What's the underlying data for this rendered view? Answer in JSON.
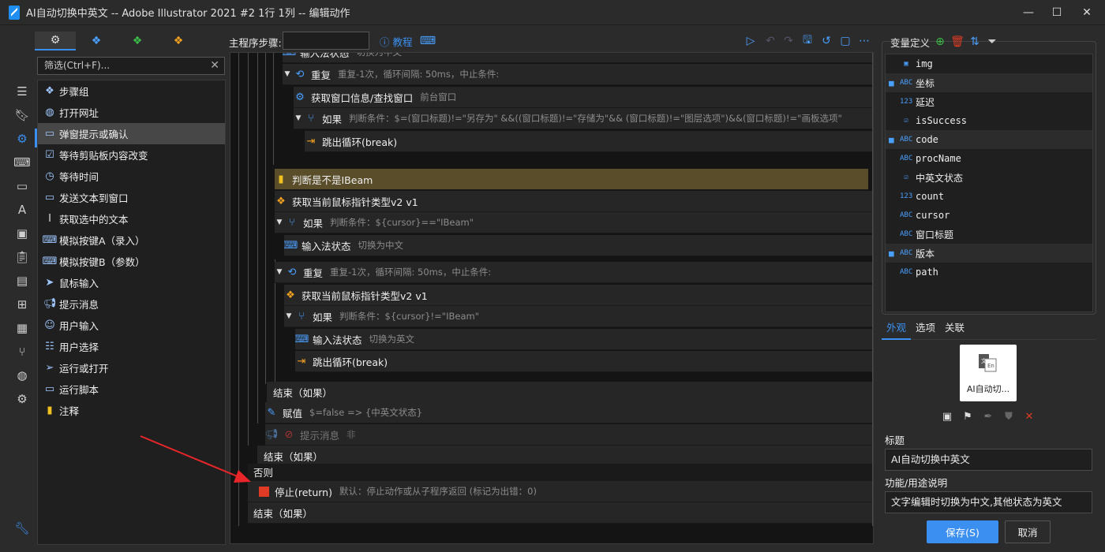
{
  "window": {
    "title": "AI自动切换中英文 -- Adobe Illustrator 2021 #2 1行 1列 -- 编辑动作",
    "controls": {
      "minimize": "—",
      "maximize": "☐",
      "close": "✕"
    }
  },
  "left_panel": {
    "filter_placeholder": "筛选(Ctrl+F)...",
    "steps": [
      {
        "label": "步骤组",
        "icon": "layers-icon"
      },
      {
        "label": "打开网址",
        "icon": "globe-icon"
      },
      {
        "label": "弹窗提示或确认",
        "icon": "dialog-icon"
      },
      {
        "label": "等待剪贴板内容改变",
        "icon": "clipboard-check-icon"
      },
      {
        "label": "等待时间",
        "icon": "timer-icon"
      },
      {
        "label": "发送文本到窗口",
        "icon": "window-text-icon"
      },
      {
        "label": "获取选中的文本",
        "icon": "text-cursor-icon"
      },
      {
        "label": "模拟按键A（录入）",
        "icon": "keyboard-icon"
      },
      {
        "label": "模拟按键B（参数）",
        "icon": "keyboard-icon"
      },
      {
        "label": "鼠标输入",
        "icon": "mouse-pointer-icon"
      },
      {
        "label": "提示消息",
        "icon": "megaphone-icon"
      },
      {
        "label": "用户输入",
        "icon": "user-edit-icon"
      },
      {
        "label": "用户选择",
        "icon": "list-select-icon"
      },
      {
        "label": "运行或打开",
        "icon": "send-icon"
      },
      {
        "label": "运行脚本",
        "icon": "script-icon"
      },
      {
        "label": "注释",
        "icon": "note-icon"
      }
    ],
    "selected_step": "弹窗提示或确认"
  },
  "toolbar": {
    "main_step_label": "主程序步骤:",
    "tutorial_label": "教程"
  },
  "editor": {
    "rows": [
      {
        "title": "输入法状态",
        "desc": "切换为中文"
      },
      {
        "title": "重复",
        "desc": "重复-1次，循环间隔: 50ms，中止条件:"
      },
      {
        "title": "获取窗口信息/查找窗口",
        "desc": "前台窗口"
      },
      {
        "title": "如果",
        "desc": "判断条件：$=(窗口标题)!=\"另存为\" &&((窗口标题)!=\"存储为\"&& (窗口标题)!=\"图层选项\")&&(窗口标题)!=\"画板选项\""
      },
      {
        "title": "跳出循环(break)",
        "desc": ""
      },
      {
        "title": "判断是不是IBeam",
        "desc": ""
      },
      {
        "title": "获取当前鼠标指针类型v2 v1",
        "desc": ""
      },
      {
        "title": "如果",
        "desc": "判断条件：${cursor}==\"IBeam\""
      },
      {
        "title": "输入法状态",
        "desc": "切换为中文"
      },
      {
        "title": "重复",
        "desc": "重复-1次，循环间隔: 50ms，中止条件:"
      },
      {
        "title": "获取当前鼠标指针类型v2 v1",
        "desc": ""
      },
      {
        "title": "如果",
        "desc": "判断条件：${cursor}!=\"IBeam\""
      },
      {
        "title": "输入法状态",
        "desc": "切换为英文"
      },
      {
        "title": "跳出循环(break)",
        "desc": ""
      },
      {
        "title": "结束（如果）",
        "desc": ""
      },
      {
        "title": "赋值",
        "desc": "$=false => {中英文状态}"
      },
      {
        "title": "提示消息",
        "desc": "非"
      },
      {
        "title": "结束（如果）",
        "desc": ""
      },
      {
        "title": "否则",
        "desc": ""
      },
      {
        "title": "停止(return)",
        "desc": "默认：停止动作或从子程序返回 (标记为出错：0)"
      },
      {
        "title": "结束（如果）",
        "desc": ""
      }
    ]
  },
  "variables": {
    "header": "变量定义",
    "items": [
      {
        "name": "img",
        "type": "image-icon",
        "group": false,
        "saved": false
      },
      {
        "name": "坐标",
        "type": "ABC",
        "group": true,
        "saved": true
      },
      {
        "name": "延迟",
        "type": "123",
        "group": false,
        "saved": false
      },
      {
        "name": "isSuccess",
        "type": "check-icon",
        "group": false,
        "saved": false
      },
      {
        "name": "code",
        "type": "ABC",
        "group": true,
        "saved": true
      },
      {
        "name": "procName",
        "type": "ABC",
        "group": false,
        "saved": false
      },
      {
        "name": "中英文状态",
        "type": "check-icon",
        "group": false,
        "saved": false
      },
      {
        "name": "count",
        "type": "123",
        "group": false,
        "saved": false
      },
      {
        "name": "cursor",
        "type": "ABC",
        "group": false,
        "saved": false
      },
      {
        "name": "窗口标题",
        "type": "ABC",
        "group": false,
        "saved": false
      },
      {
        "name": "版本",
        "type": "ABC",
        "group": true,
        "saved": true
      },
      {
        "name": "path",
        "type": "ABC",
        "group": false,
        "saved": false
      }
    ]
  },
  "properties": {
    "tabs": [
      "外观",
      "选项",
      "关联"
    ],
    "active_tab": "外观",
    "thumb_label": "AI自动切...",
    "title_label": "标题",
    "title_value": "AI自动切换中英文",
    "desc_label": "功能/用途说明",
    "desc_value": "文字编辑时切换为中文,其他状态为英文",
    "save_label": "保存(S)",
    "cancel_label": "取消"
  },
  "colors": {
    "accent": "#3b8ff0",
    "note_bg": "#5a4d2a",
    "stop_red": "#e03b24",
    "gold": "#f0a020"
  }
}
